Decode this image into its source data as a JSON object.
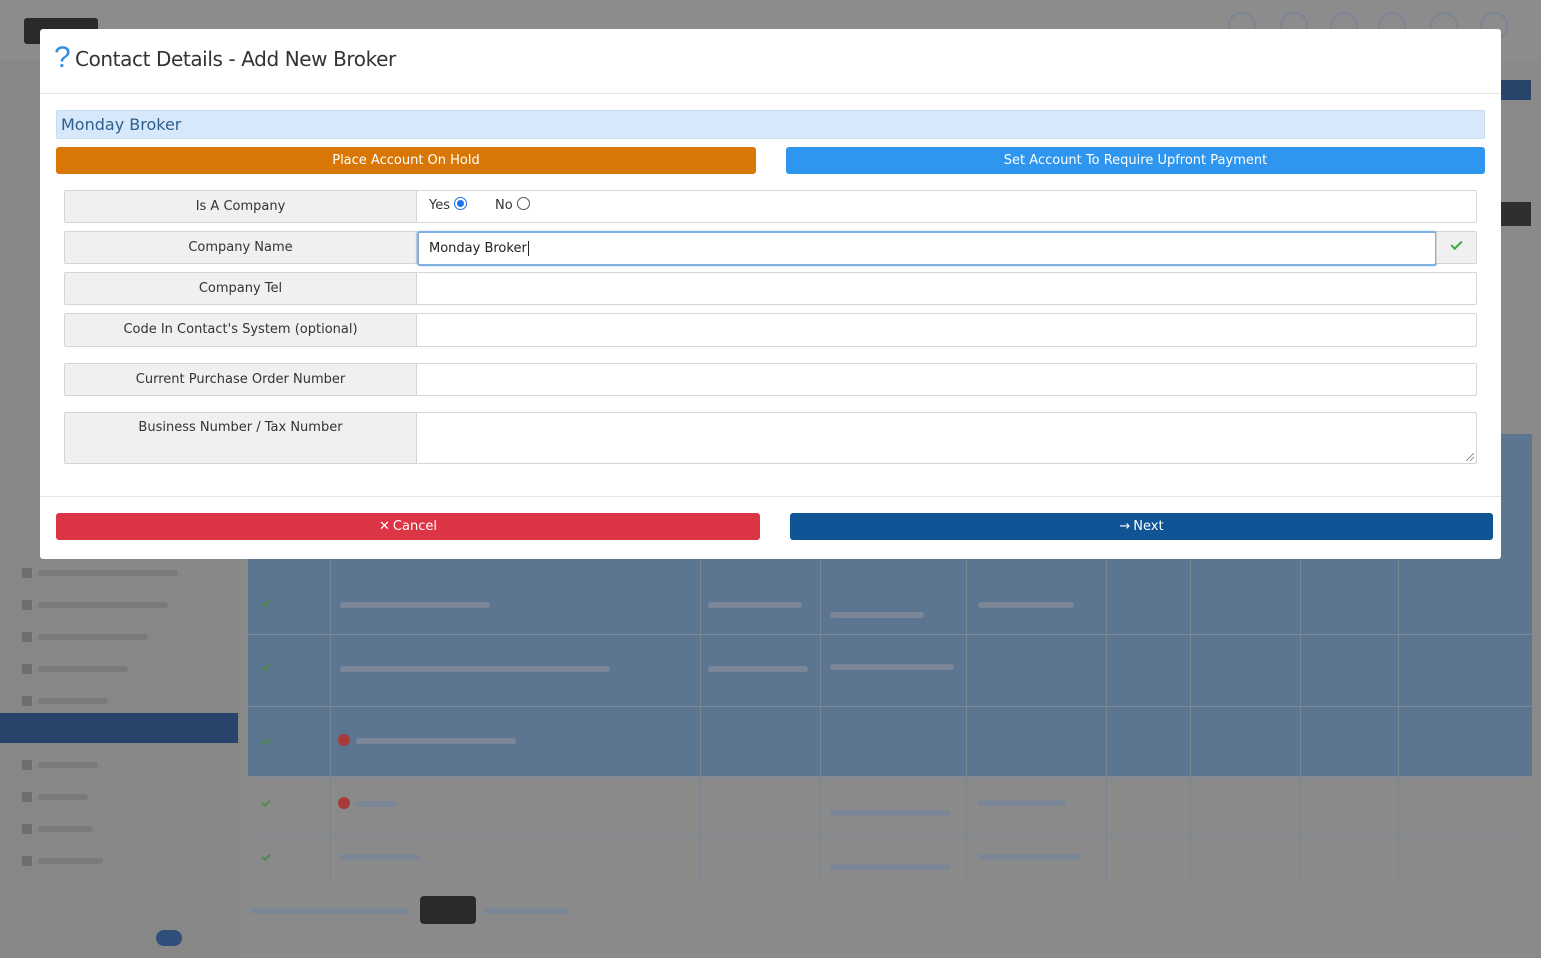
{
  "modal": {
    "help_icon": "?",
    "title": "Contact Details - Add New Broker",
    "contact_name": "Monday Broker",
    "hold_button": "Place Account On Hold",
    "upfront_button": "Set Account To Require Upfront Payment",
    "fields": {
      "is_company": {
        "label": "Is A Company",
        "yes_label": "Yes",
        "no_label": "No",
        "selected": "Yes"
      },
      "company_name": {
        "label": "Company Name",
        "value": "Monday Broker",
        "valid_icon": "check-icon"
      },
      "company_tel": {
        "label": "Company Tel",
        "value": ""
      },
      "code_in_system": {
        "label": "Code In Contact's System (optional)",
        "value": ""
      },
      "purchase_order": {
        "label": "Current Purchase Order Number",
        "value": ""
      },
      "tax_number": {
        "label": "Business Number / Tax Number",
        "value": ""
      }
    },
    "cancel_icon": "✕",
    "cancel_button": "Cancel",
    "next_icon": "→",
    "next_button": "Next"
  },
  "colors": {
    "hold": "#d97706",
    "upfront": "#2e96ee",
    "cancel": "#dc3545",
    "next": "#0f5596",
    "banner": "#d6e8f9",
    "overlay": "#808080"
  }
}
